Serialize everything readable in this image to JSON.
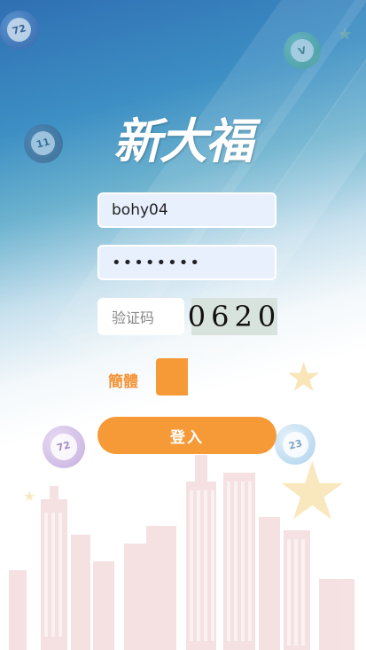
{
  "logo_text": "新大福",
  "form": {
    "username_value": "bohy04",
    "password_value": "••••••••",
    "captcha_placeholder": "验证码",
    "captcha_code": "0620"
  },
  "language": {
    "label": "簡體"
  },
  "login_button_label": "登入",
  "decor": {
    "balls": [
      "72",
      "V",
      "11",
      "72",
      "23"
    ]
  },
  "colors": {
    "accent": "#f69a38",
    "top_gradient": "#2f6fb3"
  }
}
